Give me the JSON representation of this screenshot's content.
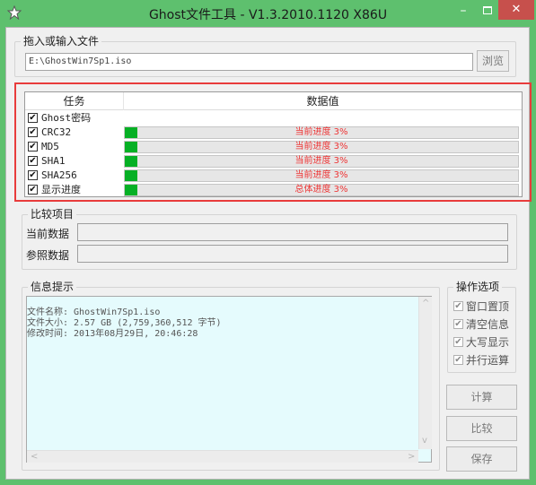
{
  "window": {
    "title": "Ghost文件工具 - V1.3.2010.1120 X86U",
    "minimize_glyph": "–",
    "close_glyph": "✕"
  },
  "file_group": {
    "label": "拖入或输入文件",
    "path": "E:\\GhostWin7Sp1.iso",
    "browse_label": "浏览"
  },
  "task_table": {
    "col_task": "任务",
    "col_value": "数据值",
    "rows": [
      {
        "label": "Ghost密码",
        "checked": true,
        "has_progress": false,
        "status": "",
        "progress_pct": 0
      },
      {
        "label": "CRC32",
        "checked": true,
        "has_progress": true,
        "status": "当前进度 3%",
        "progress_pct": 3
      },
      {
        "label": "MD5",
        "checked": true,
        "has_progress": true,
        "status": "当前进度 3%",
        "progress_pct": 3
      },
      {
        "label": "SHA1",
        "checked": true,
        "has_progress": true,
        "status": "当前进度 3%",
        "progress_pct": 3
      },
      {
        "label": "SHA256",
        "checked": true,
        "has_progress": true,
        "status": "当前进度 3%",
        "progress_pct": 3
      },
      {
        "label": "显示进度",
        "checked": true,
        "has_progress": true,
        "status": "总体进度 3%",
        "progress_pct": 3
      }
    ]
  },
  "compare_group": {
    "label": "比较项目",
    "current_label": "当前数据",
    "reference_label": "参照数据",
    "current_value": "",
    "reference_value": ""
  },
  "info_group": {
    "label": "信息提示",
    "text": "文件名称: GhostWin7Sp1.iso\n文件大小: 2.57 GB (2,759,360,512 字节)\n修改时间: 2013年08月29日, 20:46:28"
  },
  "options_group": {
    "label": "操作选项",
    "items": [
      {
        "label": "窗口置顶",
        "checked": true
      },
      {
        "label": "清空信息",
        "checked": true
      },
      {
        "label": "大写显示",
        "checked": true
      },
      {
        "label": "并行运算",
        "checked": true
      }
    ]
  },
  "actions": {
    "calculate_label": "计算",
    "compare_label": "比较",
    "save_label": "保存"
  },
  "colors": {
    "progress_fill": "#06b025",
    "status_text": "#e33333",
    "highlight_border": "#e83b3b",
    "title_bar": "#5ec06e",
    "close_button": "#c7504c",
    "info_background": "#e5fbfd"
  }
}
